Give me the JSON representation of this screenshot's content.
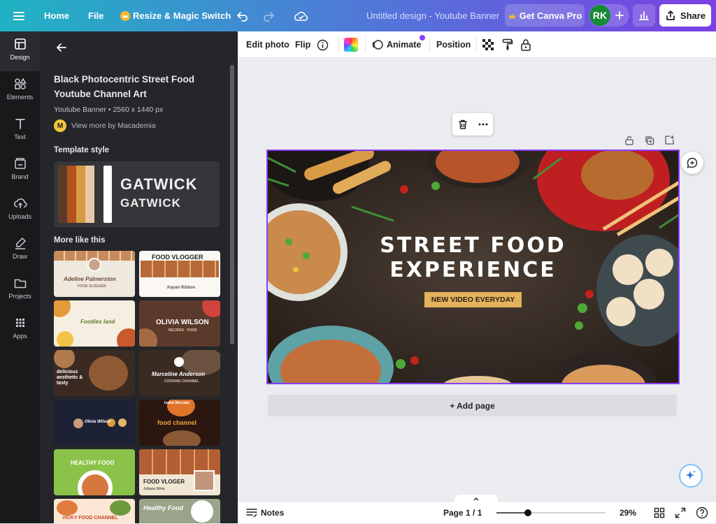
{
  "topbar": {
    "home": "Home",
    "file": "File",
    "resize": "Resize & Magic Switch",
    "title": "Untitled design - Youtube Banner",
    "get_pro": "Get Canva Pro",
    "avatar": "RK",
    "share": "Share"
  },
  "rail": {
    "design": "Design",
    "elements": "Elements",
    "text": "Text",
    "brand": "Brand",
    "uploads": "Uploads",
    "draw": "Draw",
    "projects": "Projects",
    "apps": "Apps"
  },
  "panel": {
    "template_title_1": "Black Photocentric Street Food",
    "template_title_2": "Youtube Channel Art",
    "meta": "Youtube Banner • 2560 x 1440 px",
    "author_initial": "M",
    "author_link": "View more by Macademia",
    "style_heading": "Template style",
    "style_font_1": "GATWICK",
    "style_font_2": "GATWICK",
    "palette": [
      "#5b3a29",
      "#b1521f",
      "#d69b42",
      "#e7c9a8",
      "#ffffff"
    ],
    "more_heading": "More like this",
    "thumbs": [
      {
        "text": "Adeline Palmerston",
        "sub": "FOOD VLOGGER"
      },
      {
        "text": "FOOD VLOGGER",
        "sub": "Kayah Ribbon"
      },
      {
        "text": "Foodies land",
        "sub": ""
      },
      {
        "text": "OLIVIA WILSON",
        "sub": "RECIPES · FOOD"
      },
      {
        "text": "delicious aesthetic & tasty",
        "sub": ""
      },
      {
        "text": "Marceline Anderson",
        "sub": "COOKING CHANNEL"
      },
      {
        "text": "Olivia Wilson",
        "sub": ""
      },
      {
        "text": "food channel",
        "sub": "Isabel Mercado"
      },
      {
        "text": "HEALTHY FOOD",
        "sub": ""
      },
      {
        "text": "FOOD VLOGER",
        "sub": "Juliana Silva"
      },
      {
        "text": "VICKY FOOD CHANNEL",
        "sub": ""
      },
      {
        "text": "Healthy Food",
        "sub": ""
      }
    ]
  },
  "toolbar": {
    "edit_photo": "Edit photo",
    "flip": "Flip",
    "animate": "Animate",
    "position": "Position"
  },
  "canvas": {
    "headline_1": "STREET FOOD",
    "headline_2": "EXPERIENCE",
    "tagline": "NEW VIDEO EVERYDAY",
    "add_page": "+ Add page"
  },
  "bottombar": {
    "notes": "Notes",
    "page": "Page 1 / 1",
    "zoom": "29%",
    "zoom_level": 0.29
  }
}
